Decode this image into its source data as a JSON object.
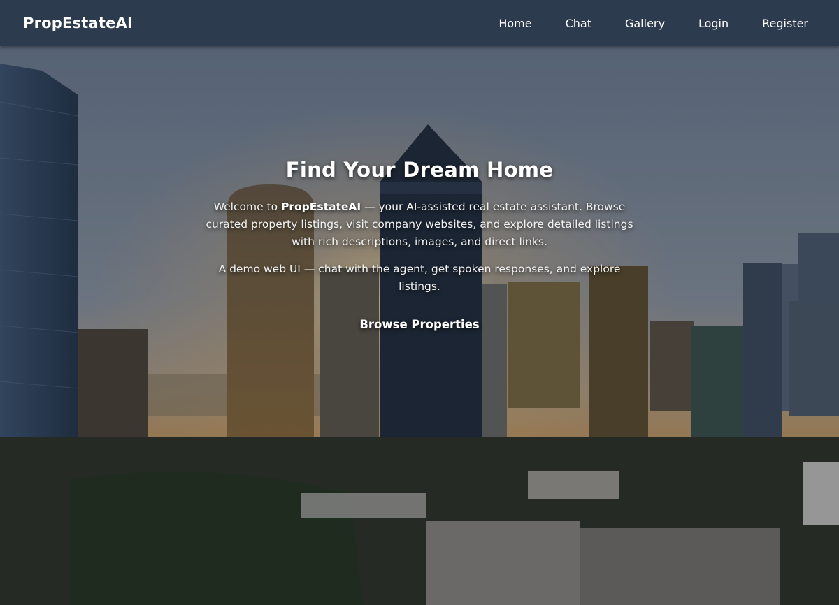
{
  "navbar": {
    "brand": "PropEstateAI",
    "links": [
      {
        "label": "Home"
      },
      {
        "label": "Chat"
      },
      {
        "label": "Gallery"
      },
      {
        "label": "Login"
      },
      {
        "label": "Register"
      }
    ]
  },
  "hero": {
    "title": "Find Your Dream Home",
    "intro_prefix": "Welcome to ",
    "intro_brand": "PropEstateAI",
    "intro_suffix": " — your AI-assisted real estate assistant. Browse curated property listings, visit company websites, and explore detailed listings with rich descriptions, images, and direct links.",
    "subtext": "A demo web UI — chat with the agent, get spoken responses, and explore listings.",
    "cta_label": "Browse Properties",
    "background_image": "city-skyline-photo"
  },
  "colors": {
    "navbar_bg": "#2c3b4d",
    "text": "#ffffff"
  }
}
